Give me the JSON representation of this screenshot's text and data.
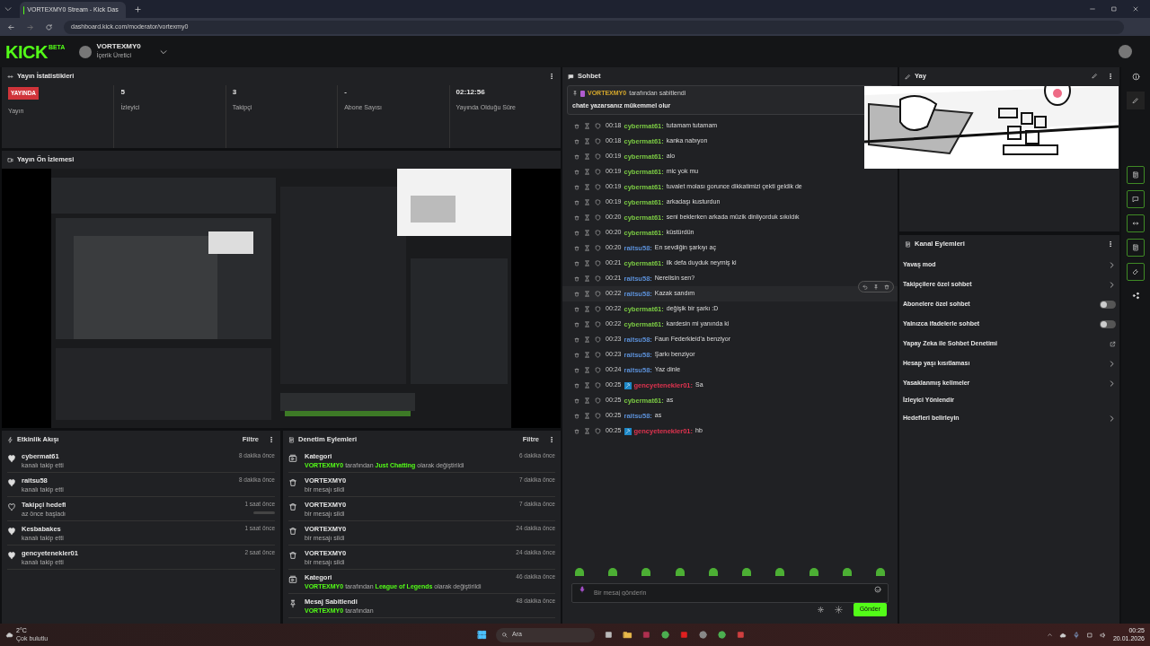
{
  "browser": {
    "tab_title": "VORTEXMY0 Stream - Kick Das",
    "url": "dashboard.kick.com/moderator/vortexmy0"
  },
  "header": {
    "logo": "KICK",
    "logo_badge": "BETA",
    "channel": "VORTEXMY0",
    "role": "İçerik Üretici"
  },
  "stats": {
    "title": "Yayın İstatistikleri",
    "live_badge": "YAYINDA",
    "items": [
      {
        "value": "",
        "label": "Yayın"
      },
      {
        "value": "5",
        "label": "İzleyici"
      },
      {
        "value": "3",
        "label": "Takipçi"
      },
      {
        "value": "-",
        "label": "Abone Sayısı"
      },
      {
        "value": "02:12:56",
        "label": "Yayında Olduğu Süre"
      }
    ]
  },
  "preview": {
    "title": "Yayın Ön İzlemesi"
  },
  "activity": {
    "title": "Etkinlik Akışı",
    "filter": "Filtre",
    "items": [
      {
        "kind": "follow",
        "name": "cybermat61",
        "detail": "kanalı takip etti",
        "time": "8 dakika önce"
      },
      {
        "kind": "follow",
        "name": "raitsu58",
        "detail": "kanalı takip etti",
        "time": "8 dakika önce"
      },
      {
        "kind": "goal",
        "name": "Takipçi hedefi",
        "detail": "az önce başladı",
        "time": "1 saat önce",
        "level": 0
      },
      {
        "kind": "follow",
        "name": "Kesbabakes",
        "detail": "kanalı takip etti",
        "time": "1 saat önce"
      },
      {
        "kind": "follow",
        "name": "gencyetenekler01",
        "detail": "kanalı takip etti",
        "time": "2 saat önce"
      }
    ]
  },
  "moderation": {
    "title": "Denetim Eylemleri",
    "filter": "Filtre",
    "items": [
      {
        "kind": "category",
        "title": "Kategori",
        "detail": "**VORTEXMY0** tarafından **Just Chatting** olarak değiştirildi",
        "time": "6 dakika önce"
      },
      {
        "kind": "delete",
        "title": "VORTEXMY0",
        "detail": "bir mesajı sildi",
        "time": "7 dakika önce"
      },
      {
        "kind": "delete",
        "title": "VORTEXMY0",
        "detail": "bir mesajı sildi",
        "time": "7 dakika önce"
      },
      {
        "kind": "delete",
        "title": "VORTEXMY0",
        "detail": "bir mesajı sildi",
        "time": "24 dakika önce"
      },
      {
        "kind": "delete",
        "title": "VORTEXMY0",
        "detail": "bir mesajı sildi",
        "time": "24 dakika önce"
      },
      {
        "kind": "category",
        "title": "Kategori",
        "detail": "**VORTEXMY0** tarafından **League of Legends** olarak değiştirildi",
        "time": "46 dakika önce"
      },
      {
        "kind": "pin",
        "title": "Mesaj Sabitlendi",
        "detail": "**VORTEXMY0** tarafından",
        "time": "48 dakika önce"
      }
    ]
  },
  "chat": {
    "title": "Sohbet",
    "pinned": {
      "user": "VORTEXMY0",
      "suffix": "tarafından sabitlendi",
      "text": "chate yazarsanız mükemmel olur"
    },
    "messages": [
      {
        "time": "00:18",
        "user": "cybermat61:",
        "color": "#7ac943",
        "text": "tutamam tutamam",
        "badge": false,
        "hovered": false
      },
      {
        "time": "00:18",
        "user": "cybermat61:",
        "color": "#7ac943",
        "text": "kanka nabıyon",
        "badge": false,
        "hovered": false
      },
      {
        "time": "00:19",
        "user": "cybermat61:",
        "color": "#7ac943",
        "text": "alo",
        "badge": false,
        "hovered": false
      },
      {
        "time": "00:19",
        "user": "cybermat61:",
        "color": "#7ac943",
        "text": "mic yok mu",
        "badge": false,
        "hovered": false
      },
      {
        "time": "00:19",
        "user": "cybermat61:",
        "color": "#7ac943",
        "text": "tuvalet molası gorunce dikkatimizi çekti geldik de",
        "badge": false,
        "hovered": false
      },
      {
        "time": "00:19",
        "user": "cybermat61:",
        "color": "#7ac943",
        "text": "arkadaşı kusturdun",
        "badge": false,
        "hovered": false
      },
      {
        "time": "00:20",
        "user": "cybermat61:",
        "color": "#7ac943",
        "text": "seni beklerken arkada müzik dinliyorduk sıkıldık",
        "badge": false,
        "hovered": false
      },
      {
        "time": "00:20",
        "user": "cybermat61:",
        "color": "#7ac943",
        "text": "küstürdün",
        "badge": false,
        "hovered": false
      },
      {
        "time": "00:20",
        "user": "raitsu58:",
        "color": "#5b8fd6",
        "text": "En sevdiğin şarkıyı aç",
        "badge": false,
        "hovered": false
      },
      {
        "time": "00:21",
        "user": "cybermat61:",
        "color": "#7ac943",
        "text": "ilk defa duyduk neymiş ki",
        "badge": false,
        "hovered": false
      },
      {
        "time": "00:21",
        "user": "raitsu58:",
        "color": "#5b8fd6",
        "text": "Nerelisin sen?",
        "badge": false,
        "hovered": false
      },
      {
        "time": "00:22",
        "user": "raitsu58:",
        "color": "#5b8fd6",
        "text": "Kazak sandım",
        "badge": false,
        "hovered": true
      },
      {
        "time": "00:22",
        "user": "cybermat61:",
        "color": "#7ac943",
        "text": "değişik bir şarkı :D",
        "badge": false,
        "hovered": false
      },
      {
        "time": "00:22",
        "user": "cybermat61:",
        "color": "#7ac943",
        "text": "kardesin mi yanında ki",
        "badge": false,
        "hovered": false
      },
      {
        "time": "00:23",
        "user": "raitsu58:",
        "color": "#5b8fd6",
        "text": "Faun Federkleid'a benziyor",
        "badge": false,
        "hovered": false
      },
      {
        "time": "00:23",
        "user": "raitsu58:",
        "color": "#5b8fd6",
        "text": "Şarkı benziyor",
        "badge": false,
        "hovered": false
      },
      {
        "time": "00:24",
        "user": "raitsu58:",
        "color": "#5b8fd6",
        "text": "Yaz dinle",
        "badge": false,
        "hovered": false
      },
      {
        "time": "00:25",
        "user": "gencyetenekler01:",
        "color": "#e0334f",
        "text": "Sa",
        "badge": true,
        "hovered": false
      },
      {
        "time": "00:25",
        "user": "cybermat61:",
        "color": "#7ac943",
        "text": "as",
        "badge": false,
        "hovered": false
      },
      {
        "time": "00:25",
        "user": "raitsu58:",
        "color": "#5b8fd6",
        "text": "as",
        "badge": false,
        "hovered": false
      },
      {
        "time": "00:25",
        "user": "gencyetenekler01:",
        "color": "#e0334f",
        "text": "hb",
        "badge": true,
        "hovered": false
      }
    ],
    "placeholder": "Bir mesaj gönderin",
    "send": "Gönder"
  },
  "top_right_panel": {
    "title": "Yay"
  },
  "channel_actions": {
    "title": "Kanal Eylemleri",
    "items": [
      {
        "kind": "arrow",
        "label": "Yavaş mod"
      },
      {
        "kind": "arrow",
        "label": "Takipçilere özel sohbet"
      },
      {
        "kind": "toggle",
        "label": "Abonelere özel sohbet",
        "on": false
      },
      {
        "kind": "toggle",
        "label": "Yalnızca ifadelerle sohbet",
        "on": false
      },
      {
        "kind": "external",
        "label": "Yapay Zeka ile Sohbet Denetimi"
      },
      {
        "kind": "arrow",
        "label": "Hesap yaşı kısıtlaması"
      },
      {
        "kind": "arrow",
        "label": "Yasaklanmış kelimeler"
      },
      {
        "kind": "plain",
        "label": "İzleyici Yönlendir"
      },
      {
        "kind": "arrow",
        "label": "Hedefleri belirleyin"
      }
    ]
  },
  "taskbar": {
    "temperature": "2°C",
    "weather": "Çok bulutlu",
    "search": "Ara",
    "time": "00:25",
    "date": "20.01.2026"
  }
}
